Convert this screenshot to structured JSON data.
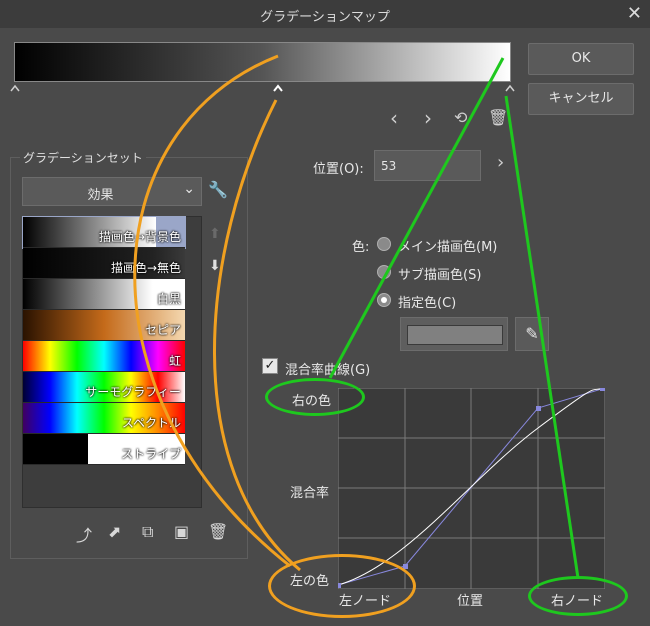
{
  "window": {
    "title": "グラデーションマップ",
    "close_icon": "close-icon"
  },
  "buttons": {
    "ok": "OK",
    "cancel": "キャンセル"
  },
  "position": {
    "label": "位置(O):",
    "value": "53"
  },
  "gradient_set": {
    "label": "グラデーションセット",
    "dropdown_value": "効果",
    "items": [
      {
        "label": "描画色→背景色"
      },
      {
        "label": "描画色→無色"
      },
      {
        "label": "白黒"
      },
      {
        "label": "セピア"
      },
      {
        "label": "虹"
      },
      {
        "label": "サーモグラフィー"
      },
      {
        "label": "スペクトル"
      },
      {
        "label": "ストライプ"
      }
    ]
  },
  "color": {
    "label": "色:",
    "options": [
      "メイン描画色(M)",
      "サブ描画色(S)",
      "指定色(C)"
    ],
    "selected": "指定色(C)",
    "swatch_color": "#808080"
  },
  "blend_curve": {
    "label": "混合率曲線(G)",
    "checked": true,
    "right_color": "右の色",
    "left_color": "左の色",
    "blend_rate": "混合率",
    "left_node": "左ノード",
    "position": "位置",
    "right_node": "右ノード"
  },
  "colors": {
    "green_annotation": "#1ec81e",
    "orange_annotation": "#f0a020"
  }
}
